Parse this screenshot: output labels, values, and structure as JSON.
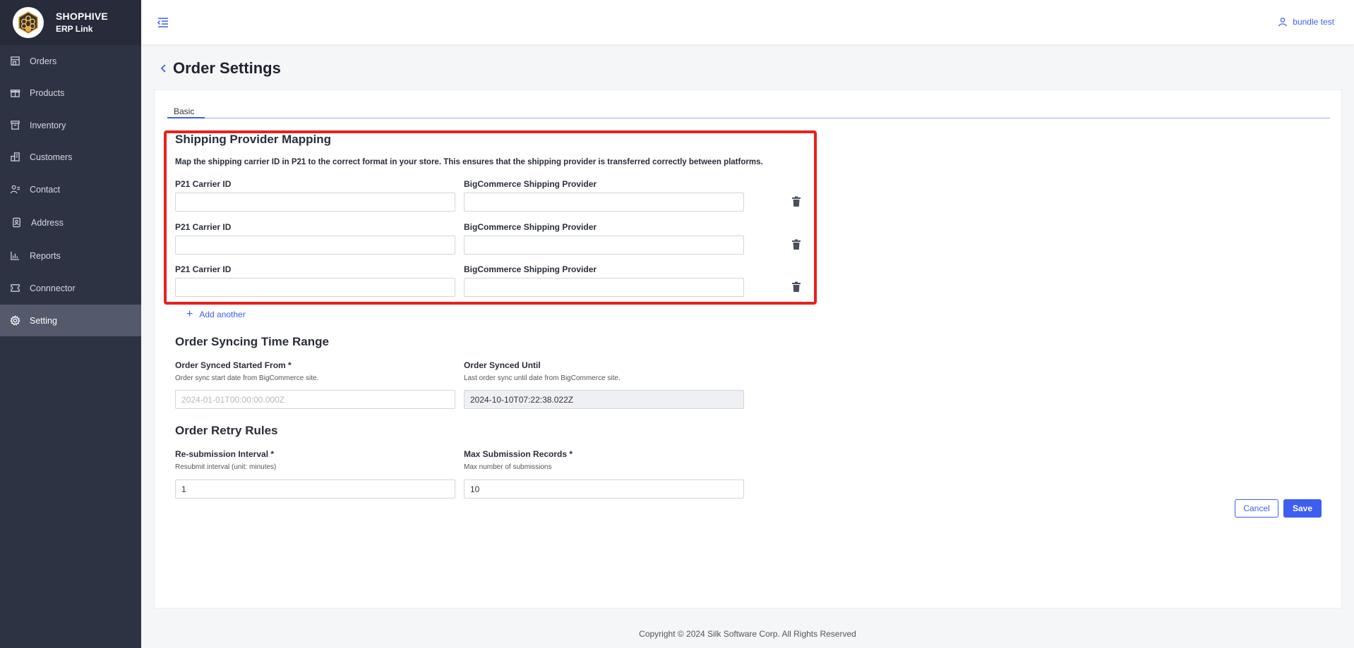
{
  "brand": {
    "name": "SHOPHIVE",
    "sub": "ERP Link"
  },
  "sidebar": {
    "items": [
      {
        "label": "Orders",
        "icon": "store-icon"
      },
      {
        "label": "Products",
        "icon": "gift-icon"
      },
      {
        "label": "Inventory",
        "icon": "archive-icon"
      },
      {
        "label": "Customers",
        "icon": "buildings-icon"
      },
      {
        "label": "Contact",
        "icon": "contact-icon"
      },
      {
        "label": "Address",
        "icon": "address-book-icon"
      },
      {
        "label": "Reports",
        "icon": "bar-chart-icon"
      },
      {
        "label": "Connnector",
        "icon": "ticket-icon"
      },
      {
        "label": "Setting",
        "icon": "gear-icon",
        "active": true
      }
    ]
  },
  "header": {
    "user": "bundle test"
  },
  "page": {
    "title": "Order Settings"
  },
  "tabs": [
    {
      "label": "Basic",
      "active": true
    }
  ],
  "shipping": {
    "title": "Shipping Provider Mapping",
    "description": "Map the shipping carrier ID in P21 to the correct format in your store. This ensures that the shipping provider is transferred correctly between platforms.",
    "carrier_label": "P21 Carrier ID",
    "provider_label": "BigCommerce Shipping Provider",
    "rows": [
      {
        "carrier": "",
        "provider": ""
      },
      {
        "carrier": "",
        "provider": ""
      },
      {
        "carrier": "",
        "provider": ""
      }
    ],
    "add_label": "Add another"
  },
  "syncing": {
    "title": "Order Syncing Time Range",
    "from_label": "Order Synced Started From *",
    "from_hint": "Order sync start date from BigCommerce site.",
    "from_placeholder": "2024-01-01T00:00:00.000Z",
    "until_label": "Order Synced Until",
    "until_hint": "Last order sync until date from BigCommerce site.",
    "until_value": "2024-10-10T07:22:38.022Z"
  },
  "retry": {
    "title": "Order Retry Rules",
    "interval_label": "Re-submission Interval *",
    "interval_hint": "Resubmit interval (unit: minutes)",
    "interval_value": "1",
    "max_label": "Max Submission Records *",
    "max_hint": "Max number of submissions",
    "max_value": "10"
  },
  "actions": {
    "cancel": "Cancel",
    "save": "Save"
  },
  "footer": {
    "copyright": "Copyright © 2024 Silk Software Corp. All Rights Reserved"
  },
  "colors": {
    "accent": "#3d5ef0",
    "sidebar": "#2e3344",
    "highlight": "#e8211e"
  }
}
